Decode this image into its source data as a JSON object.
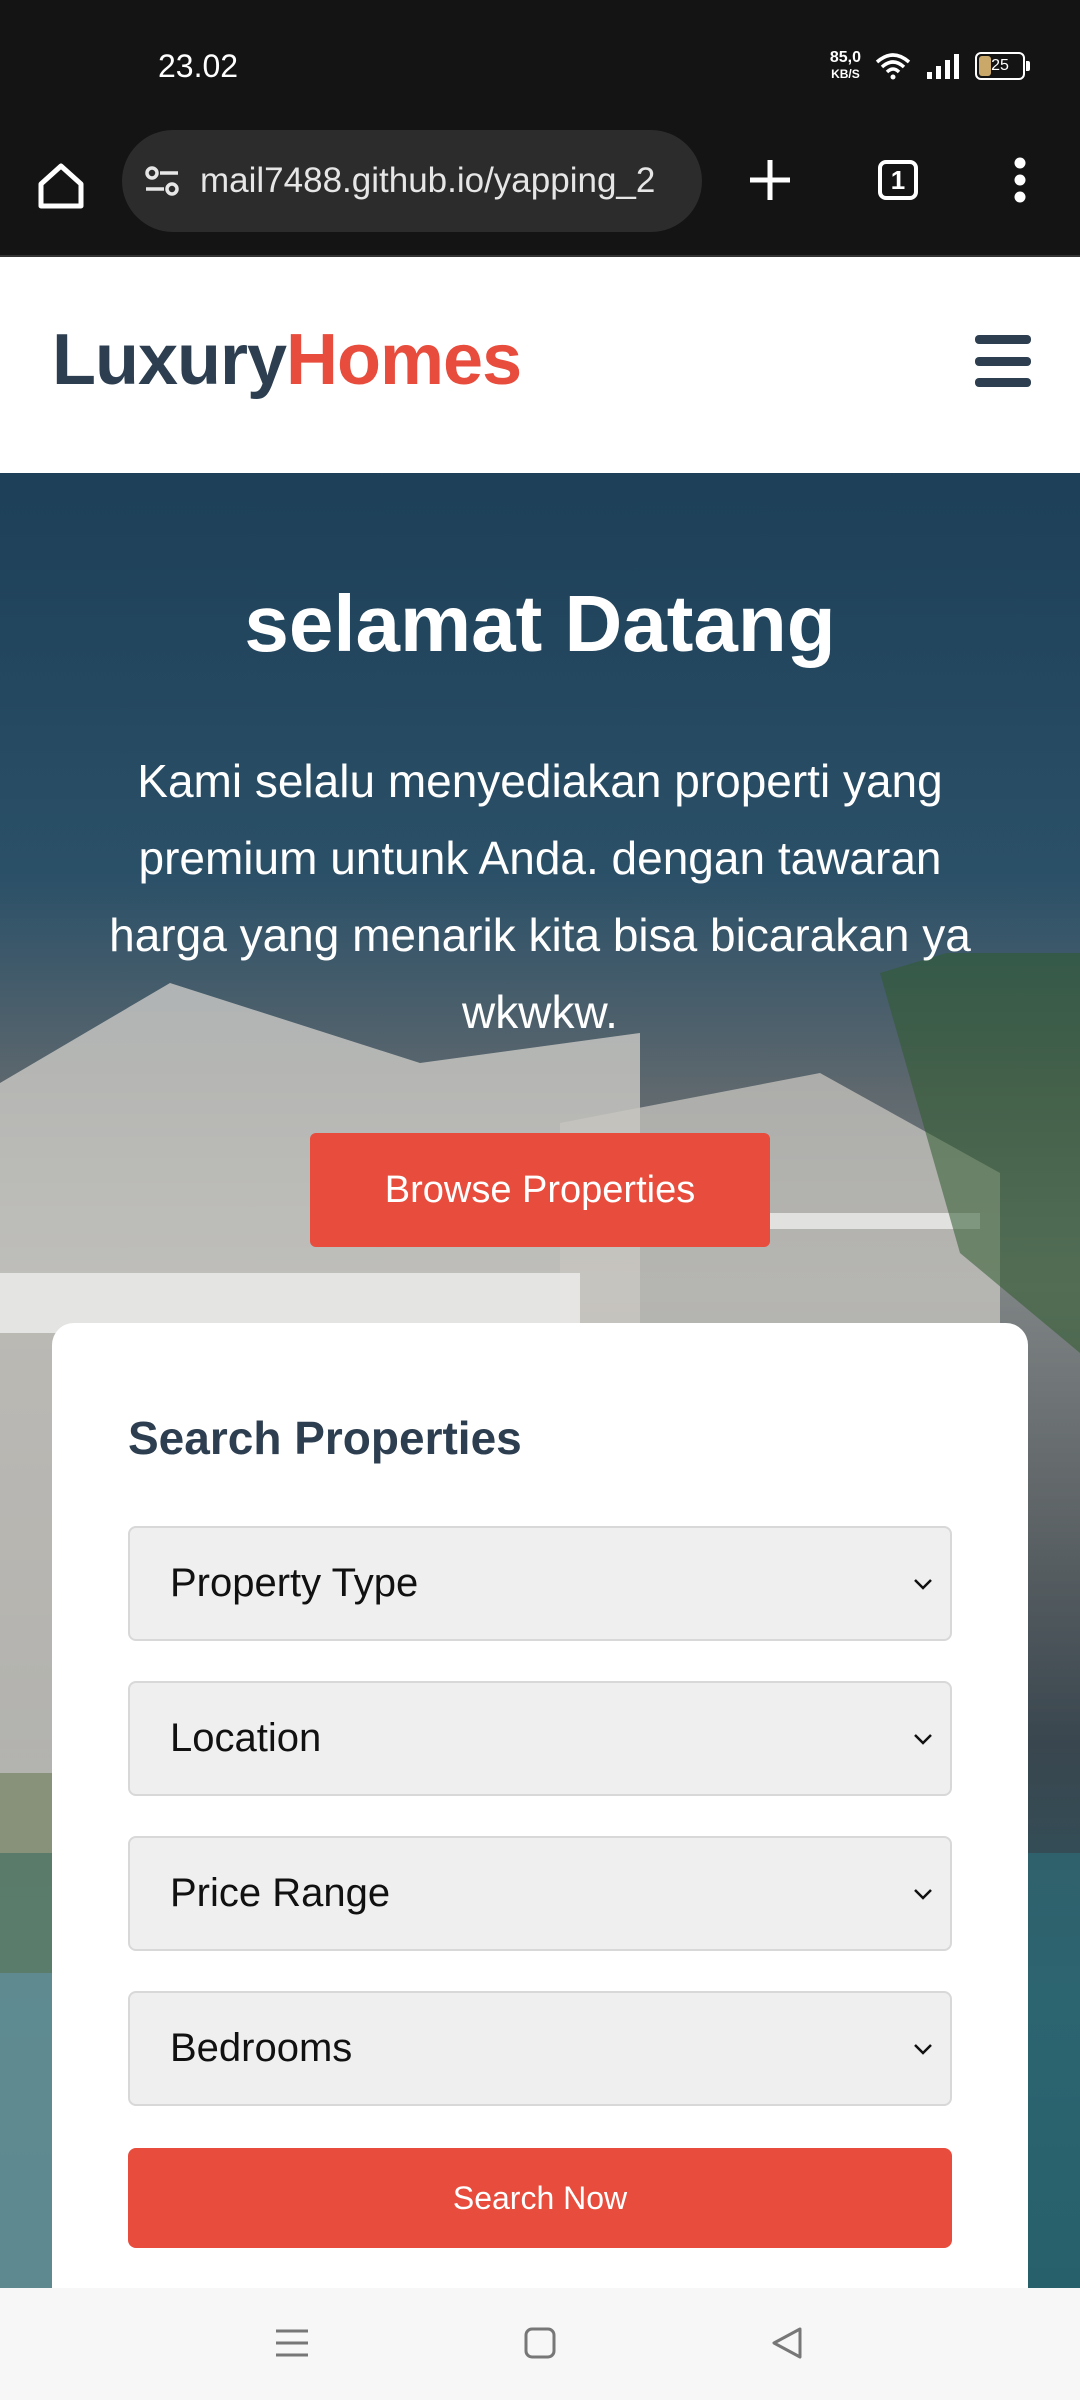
{
  "status_bar": {
    "time": "23.02",
    "net_speed_value": "85,0",
    "net_speed_unit": "KB/S",
    "battery_level": "25"
  },
  "browser": {
    "url": "mail7488.github.io/yapping_2",
    "tab_count": "1"
  },
  "header": {
    "logo_part1": "Luxury",
    "logo_part2": "Homes"
  },
  "hero": {
    "title": "selamat Datang",
    "text": "Kami selalu menyediakan properti yang premium untunk Anda. dengan tawaran harga yang menarik kita bisa bicarakan ya wkwkw.",
    "button_label": "Browse Properties"
  },
  "search": {
    "title": "Search Properties",
    "fields": [
      {
        "label": "Property Type"
      },
      {
        "label": "Location"
      },
      {
        "label": "Price Range"
      },
      {
        "label": "Bedrooms"
      }
    ],
    "button_label": "Search Now"
  },
  "colors": {
    "accent": "#e74c3c",
    "navy": "#2c3e50"
  }
}
